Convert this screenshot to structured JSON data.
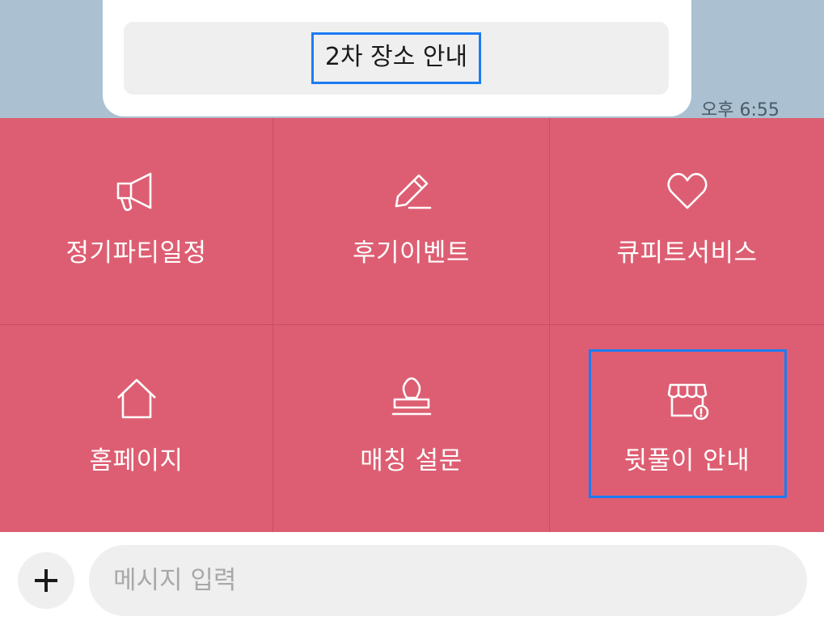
{
  "chat": {
    "bubble_button_label": "2차 장소 안내",
    "timestamp": "오후 6:55"
  },
  "menu": {
    "items": [
      {
        "label": "정기파티일정",
        "icon": "megaphone-icon"
      },
      {
        "label": "후기이벤트",
        "icon": "pencil-icon"
      },
      {
        "label": "큐피트서비스",
        "icon": "heart-icon"
      },
      {
        "label": "홈페이지",
        "icon": "home-icon"
      },
      {
        "label": "매칭 설문",
        "icon": "stamp-icon"
      },
      {
        "label": "뒷풀이 안내",
        "icon": "store-alert-icon"
      }
    ],
    "background_color": "#dd5e72"
  },
  "input": {
    "placeholder": "메시지 입력",
    "plus_icon": "plus-icon"
  },
  "colors": {
    "chat_background": "#abc1d1",
    "highlight": "#1d7bf2"
  }
}
